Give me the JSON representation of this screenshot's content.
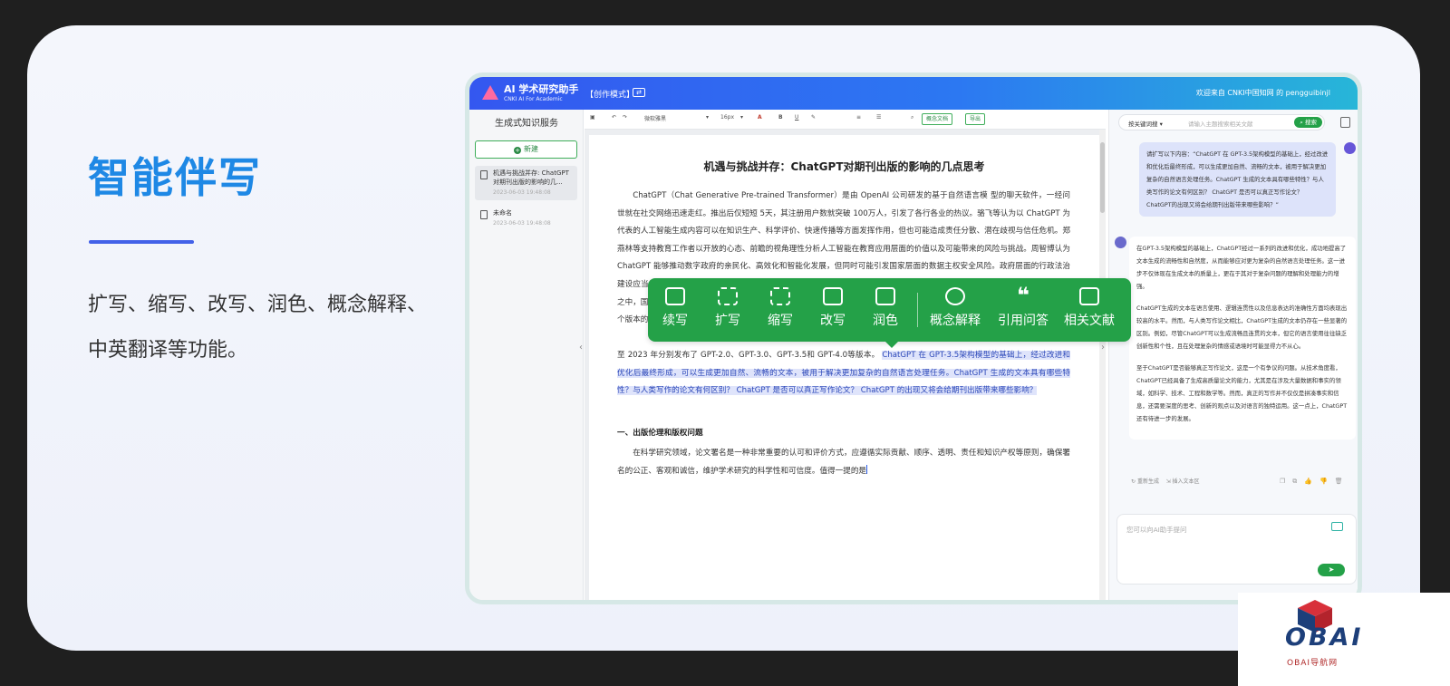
{
  "hero": {
    "title": "智能伴写",
    "description": "扩写、缩写、改写、润色、概念解释、中英翻译等功能。"
  },
  "app": {
    "logo_title": "AI 学术研究助手",
    "logo_sub": "CNKI AI For Academic",
    "mode": "【创作模式】",
    "welcome": "欢迎来自 CNKI中国知网 的 pengguibinjl",
    "sidebar": {
      "title": "生成式知识服务",
      "new_label": "新建",
      "items": [
        {
          "title": "机遇与挑战并存: ChatGPT对期刊出版的影响的几...",
          "time": "2023-06-03 19:48:08"
        },
        {
          "title": "未命名",
          "time": "2023-06-03 19:48:08"
        }
      ]
    },
    "toolbar": {
      "font": "微软雅黑",
      "size": "16px",
      "concept_btn": "概念文档",
      "export_btn": "导出"
    },
    "doc": {
      "title": "机遇与挑战并存：ChatGPT对期刊出版的影响的几点思考",
      "p1": "ChatGPT（Chat Generative Pre-trained Transformer）是由 OpenAI 公司研发的基于自然语言模 型的聊天软件，一经问世就在社交网络迅速走红。推出后仅短短 5天，其注册用户数就突破 100万人，引发了各行各业的热议。骆飞等认为以 ChatGPT 为代表的人工智能生成内容可以在知识生产、科学评价、快速传播等方面发挥作用，但也可能造成责任分散、潜在歧视与信任危机。郑燕林等支持教育工作者以开放的心态、前瞻的视角理性分析人工智能在教育应用层面的价值以及可能带来的风险与挑战。周智博认为 ChatGPT 能够推动数字政府的亲民化、高效化和智能化发展，但同时可能引发国家层面的数据主权安全风险。政府层面的行政法治建设应当以及全人工智能的规范和监管问题。随着国外出版机构在行业在ChatGPT 的重视程度，许多机构开始参与到该技术的研究之中，国内出版也在持续关注这项技术和热点话题，并展开了一项重要功能测试。ChatGPT 的版本从 GPT-1 发展至今，已经历了多个版本的迭代，其中 OpenAI 在 2018 年发布了 GPT-1，",
      "p1_tail": "至 2023 年分别发布了 GPT-2.0、GPT-3.0、GPT-3.5和 GPT-4.0等版本。",
      "p1_selected": "ChatGPT 在 GPT-3.5架构模型的基础上，经过改进和优化后最终形成，可以生成更加自然、流畅的文本，被用于解决更加复杂的自然语言处理任务。ChatGPT 生成的文本具有哪些特性？与人类写作的论文有何区别？ ChatGPT 是否可以真正写作论文？ ChatGPT 的出现又将会给期刊出版带来哪些影响？",
      "section": "一、出版伦理和版权问题",
      "p2": "在科学研究领域，论文署名是一种非常重要的认可和评价方式，应遵循实际贡献、顺序、透明、责任和知识产权等原则，确保署名的公正、客观和诚信，维护学术研究的科学性和可信度。值得一提的是"
    },
    "floatbar": [
      {
        "label": "续写",
        "icon": "continue-write-icon"
      },
      {
        "label": "扩写",
        "icon": "expand-icon"
      },
      {
        "label": "缩写",
        "icon": "shrink-icon"
      },
      {
        "label": "改写",
        "icon": "rewrite-icon"
      },
      {
        "label": "润色",
        "icon": "polish-icon"
      },
      {
        "label": "概念解释",
        "icon": "concept-icon"
      },
      {
        "label": "引用问答",
        "icon": "quote-icon"
      },
      {
        "label": "相关文献",
        "icon": "document-icon"
      }
    ],
    "chat": {
      "search_select": "按关键词搜",
      "search_placeholder": "请输入主题搜索相关文献",
      "search_btn": "搜索",
      "user_msg": "请扩写以下内容：“ChatGPT 在 GPT-3.5架构模型的基础上，经过改进和优化后最终形成，可以生成更加自然、流畅的文本，被用于解决更加复杂的自然语言处理任务。ChatGPT 生成的文本具有哪些特性？与人类写作的论文有何区别？ ChatGPT 是否可以真正写作论文？ ChatGPT的出现又将会给期刊出版带来哪些影响？”",
      "ai_p1": "在GPT-3.5架构模型的基础上，ChatGPT经过一系列的改进和优化，成功地提高了文本生成的流畅性和自然度，从而能够应对更为复杂的自然语言处理任务。这一进步不仅体现在生成文本的质量上，更在于其对于复杂问题的理解和处理能力的增强。",
      "ai_p2": "ChatGPT生成的文本在语言使用、逻辑连贯性以及信息表达的准确性方面均表现出较高的水平。然而，与人类写作论文相比，ChatGPT生成的文本仍存在一些显著的区别。例如，尽管ChatGPT可以生成流畅且连贯的文本，但它的语言使用往往缺乏创新性和个性，且在处理复杂的情感或语境时可能显得力不从心。",
      "ai_p3": "至于ChatGPT是否能够真正写作论文，这是一个有争议的问题。从技术角度看，ChatGPT已经具备了生成高质量论文的能力，尤其是在涉及大量数据和事实的领域，如科学、技术、工程和数学等。然而，真正的写作并不仅仅是拼凑事实和信息，还需要深度的思考、创新的观点以及对语言的独特运用。这一点上，ChatGPT还有待进一步的发展。",
      "regen": "重新生成",
      "insert": "插入文本区",
      "input_placeholder": "您可以向AI助手提问",
      "send": "➤"
    }
  },
  "brand": {
    "name": "OBAI",
    "sub": "OBAI导航网"
  }
}
